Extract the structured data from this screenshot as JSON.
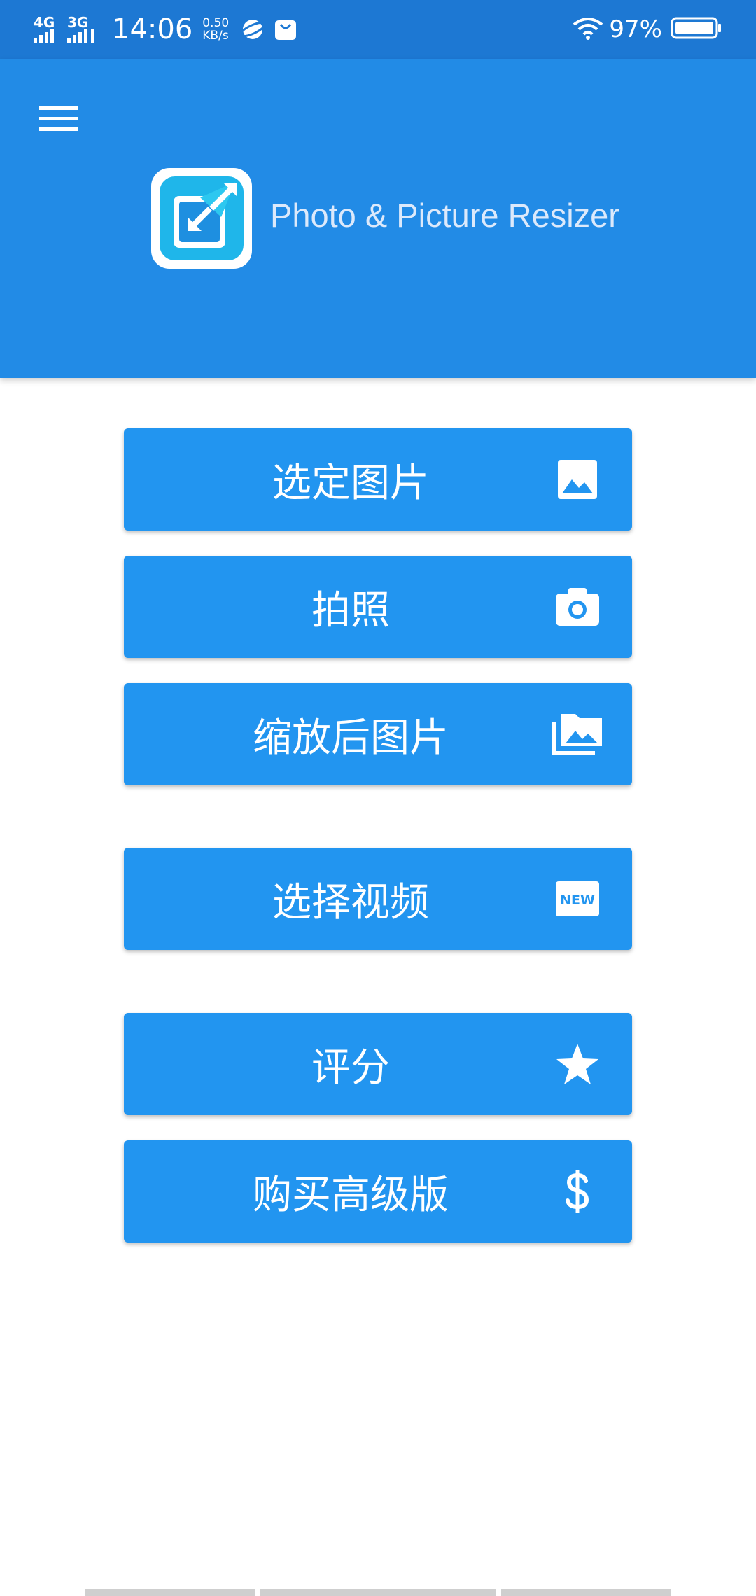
{
  "status_bar": {
    "network_1": "4G",
    "network_2": "3G",
    "time": "14:06",
    "speed_value": "0.50",
    "speed_unit": "KB/s",
    "battery": "97%"
  },
  "header": {
    "title": "Photo & Picture Resizer",
    "background_color": "#228be6"
  },
  "menu": {
    "items": [
      {
        "label": "选定图片",
        "icon": "image-icon"
      },
      {
        "label": "拍照",
        "icon": "camera-icon"
      },
      {
        "label": "缩放后图片",
        "icon": "photo-library-icon"
      },
      {
        "label": "选择视频",
        "icon": "new-badge-icon"
      },
      {
        "label": "评分",
        "icon": "star-icon"
      },
      {
        "label": "购买高级版",
        "icon": "dollar-icon"
      }
    ],
    "button_color": "#2295f0"
  }
}
